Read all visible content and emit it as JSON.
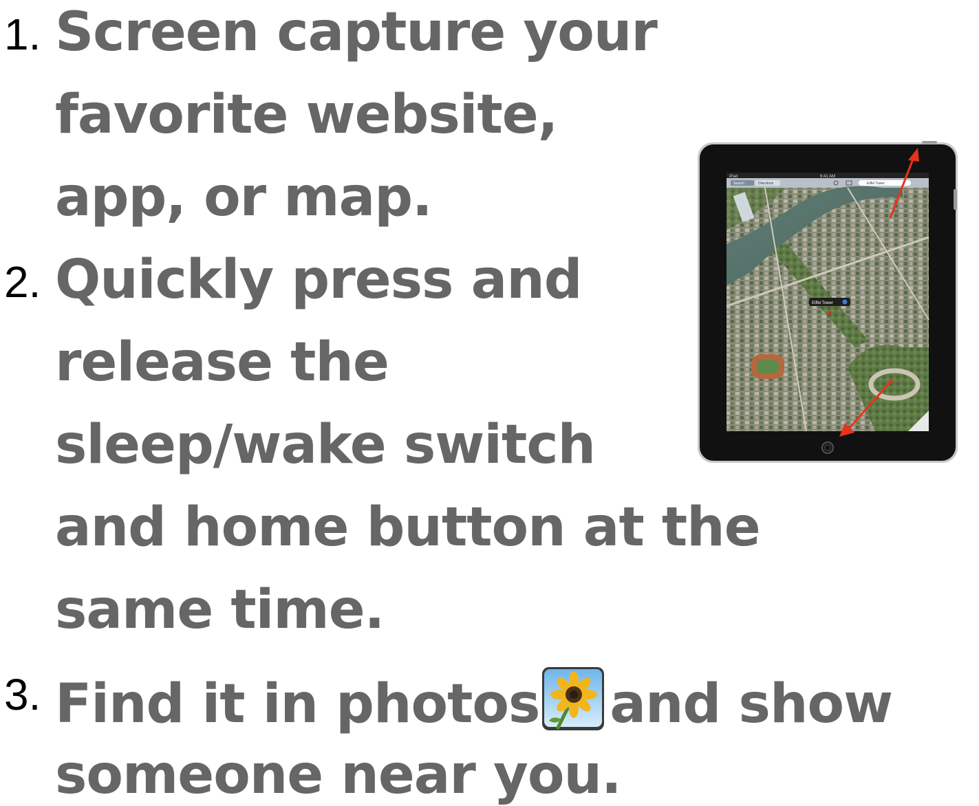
{
  "steps": [
    {
      "number": "1.",
      "lines": [
        "Screen capture your",
        "favorite website,",
        "app, or map."
      ]
    },
    {
      "number": "2.",
      "lines": [
        "Quickly press and",
        "release the",
        "sleep/wake switch",
        "and home button at the",
        "same time."
      ]
    },
    {
      "number": "3.",
      "line_before_icon": "Find it in photos",
      "line_after_icon": "and show",
      "lines": [
        "someone near you."
      ]
    }
  ],
  "ipad_screen": {
    "status_left": "iPad",
    "status_time": "9:41 AM",
    "toolbar_buttons": [
      "Search",
      "Directions"
    ],
    "search_value": "Eiffel Tower",
    "pin_label": "Eiffel Tower"
  },
  "icons": [
    "ipad-image",
    "photos-sunflower-icon",
    "arrow-to-sleep-switch-icon",
    "arrow-to-home-button-icon"
  ],
  "colors": {
    "text": "#666666",
    "numbers": "#000000",
    "arrow": "#e8321c"
  }
}
